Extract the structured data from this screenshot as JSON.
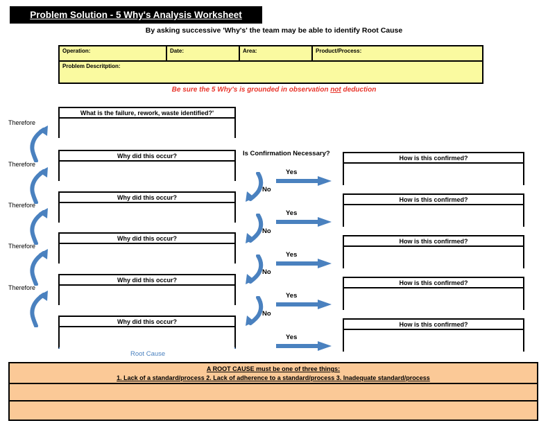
{
  "document": {
    "title": "Problem Solution - 5 Why's Analysis Worksheet",
    "subtitle": "By asking successive 'Why's' the team may be able to identify Root Cause",
    "warning_prefix": "Be sure the 5 Why's is grounded in observation ",
    "warning_emphasis": "not",
    "warning_suffix": " deduction"
  },
  "info_table": {
    "operation_label": "Operation:",
    "date_label": "Date:",
    "area_label": "Area:",
    "product_process_label": "Product/Process:",
    "problem_description_label": "Problem Descritption:",
    "operation_value": "",
    "date_value": "",
    "area_value": "",
    "product_process_value": "",
    "problem_description_value": "",
    "fill_color": "#fafaa0"
  },
  "failure_box": {
    "header": "What is the failure, rework, waste identified?'",
    "value": ""
  },
  "why_boxes": [
    {
      "header": "Why did this occur?",
      "value": ""
    },
    {
      "header": "Why did this occur?",
      "value": ""
    },
    {
      "header": "Why did this occur?",
      "value": ""
    },
    {
      "header": "Why did this occur?",
      "value": ""
    },
    {
      "header": "Why did this occur?",
      "value": ""
    }
  ],
  "confirm_boxes": [
    {
      "header": "How is this confirmed?",
      "value": ""
    },
    {
      "header": "How is this confirmed?",
      "value": ""
    },
    {
      "header": "How is this confirmed?",
      "value": ""
    },
    {
      "header": "How is this confirmed?",
      "value": ""
    },
    {
      "header": "How is this confirmed?",
      "value": ""
    }
  ],
  "confirmation_column_header": "Is Confirmation Necessary?",
  "therefore_labels": [
    "Therefore",
    "Therefore",
    "Therefore",
    "Therefore",
    "Therefore"
  ],
  "yes_labels": [
    "Yes",
    "Yes",
    "Yes",
    "Yes",
    "Yes"
  ],
  "no_labels": [
    "No",
    "No",
    "No",
    "No"
  ],
  "root_cause_label": "Root Cause",
  "footer": {
    "line1": "A ROOT CAUSE must be one of three things:",
    "line2": "1. Lack of a standard/process  2. Lack of adherence to a standard/process    3. Inadequate standard/process",
    "row2_value": "",
    "row3_value": "",
    "fill_color": "#fbc997"
  },
  "colors": {
    "accent_blue": "#4a81bf",
    "warning_red": "#e8342a",
    "title_bar": "#000000",
    "header_yellow": "#fafaa0",
    "footer_orange": "#fbc997"
  }
}
